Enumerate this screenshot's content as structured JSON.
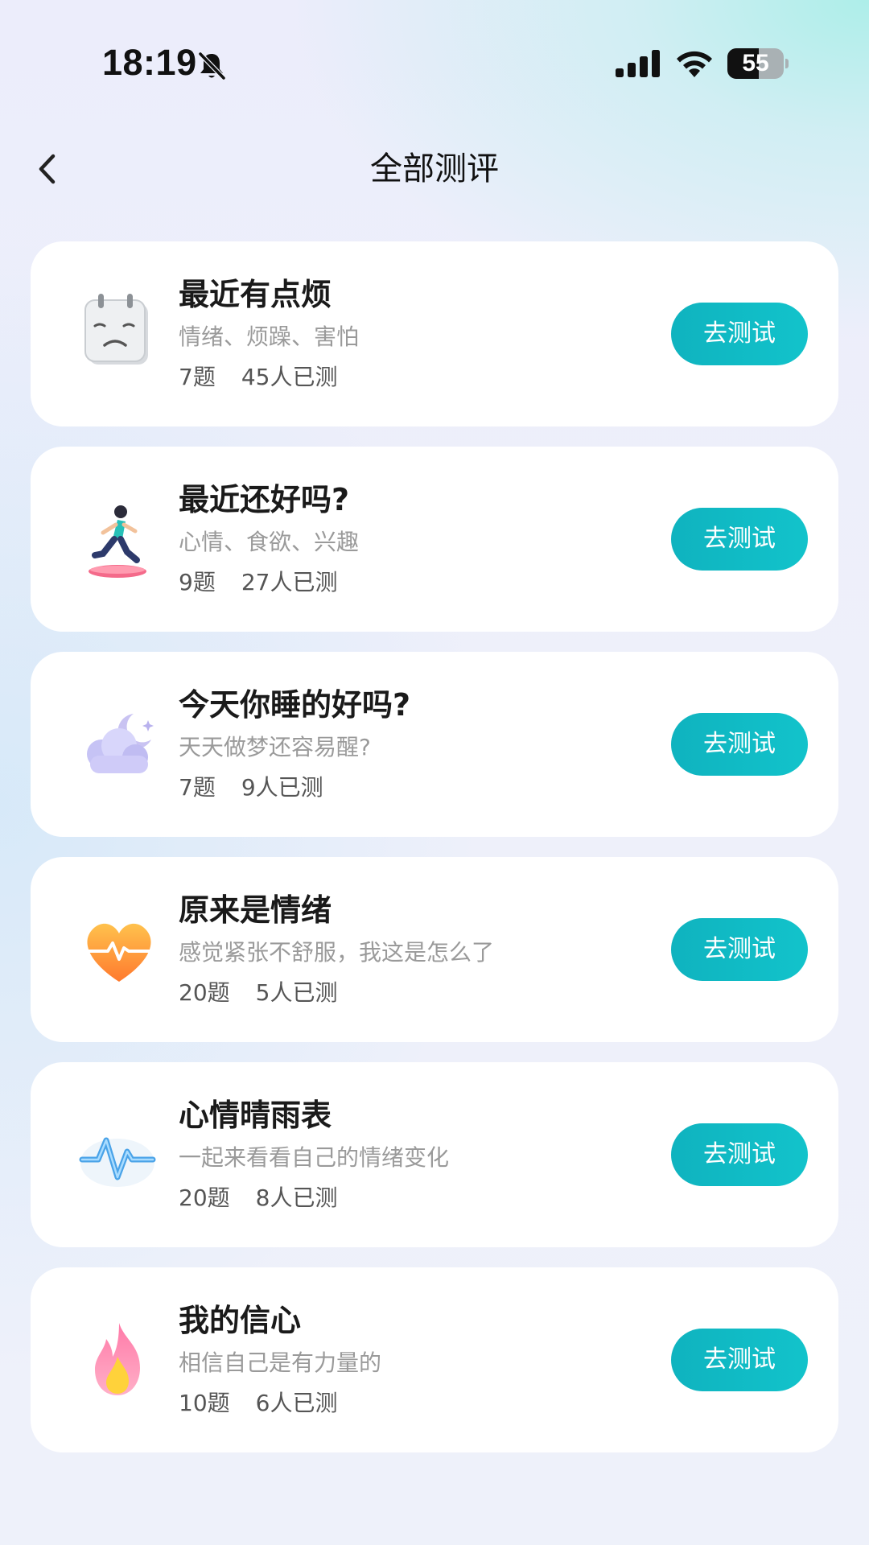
{
  "status_bar": {
    "time": "18:19",
    "battery_level": "55",
    "battery_percent": 55
  },
  "nav": {
    "title": "全部测评",
    "back_icon": "chevron-left-icon"
  },
  "colors": {
    "accent": "#12bcc6",
    "card_bg": "#ffffff",
    "title": "#1a1a1a",
    "subtitle": "#9a9a9a"
  },
  "assessments": [
    {
      "title": "最近有点烦",
      "desc": "情绪、烦躁、害怕",
      "questions": "7题",
      "participants": "45人已测",
      "button": "去测试",
      "icon": "sad-calendar-icon"
    },
    {
      "title": "最近还好吗?",
      "desc": "心情、食欲、兴趣",
      "questions": "9题",
      "participants": "27人已测",
      "button": "去测试",
      "icon": "running-person-icon"
    },
    {
      "title": "今天你睡的好吗?",
      "desc": "天天做梦还容易醒?",
      "questions": "7题",
      "participants": "9人已测",
      "button": "去测试",
      "icon": "moon-cloud-icon"
    },
    {
      "title": "原来是情绪",
      "desc": "感觉紧张不舒服，我这是怎么了",
      "questions": "20题",
      "participants": "5人已测",
      "button": "去测试",
      "icon": "heart-pulse-icon"
    },
    {
      "title": "心情晴雨表",
      "desc": "一起来看看自己的情绪变化",
      "questions": "20题",
      "participants": "8人已测",
      "button": "去测试",
      "icon": "wave-icon"
    },
    {
      "title": "我的信心",
      "desc": "相信自己是有力量的",
      "questions": "10题",
      "participants": "6人已测",
      "button": "去测试",
      "icon": "flame-icon"
    }
  ]
}
